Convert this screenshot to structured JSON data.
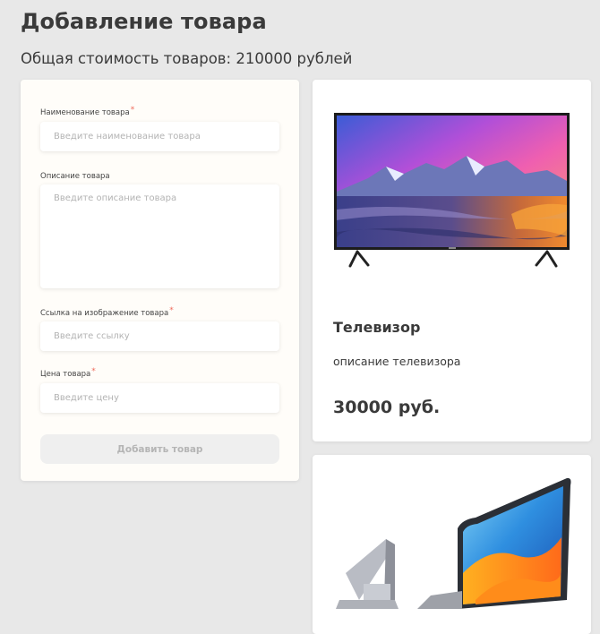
{
  "page": {
    "title": "Добавление товара",
    "total": "Общая стоимость товаров: 210000 рублей"
  },
  "form": {
    "name_label": "Наименование товара",
    "name_placeholder": "Введите наименование товара",
    "description_label": "Описание товара",
    "description_placeholder": "Введите описание товара",
    "image_label": "Ссылка на изображение товара",
    "image_placeholder": "Введите ссылку",
    "price_label": "Цена товара",
    "price_placeholder": "Введите цену",
    "required_mark": "*",
    "submit_label": "Добавить товар"
  },
  "products": [
    {
      "title": "Телевизор",
      "description": "описание телевизора",
      "price": "30000 руб."
    }
  ],
  "colors": {
    "background": "#e8e8e8",
    "card": "#ffffff",
    "form_card": "#fffdf9",
    "required": "#f06a5a",
    "button_disabled": "#efefef"
  }
}
